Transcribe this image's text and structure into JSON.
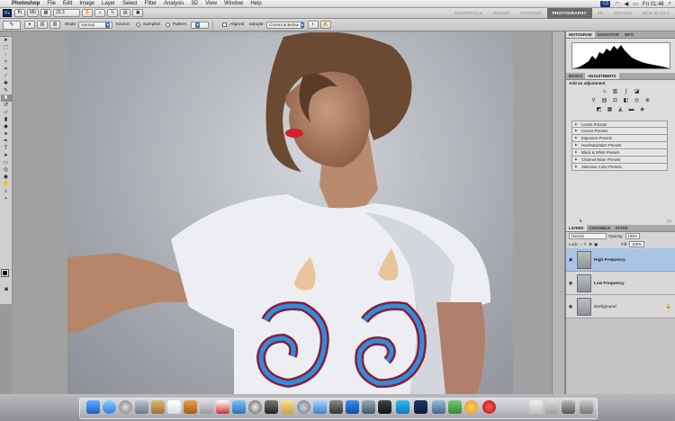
{
  "menubar": {
    "app_name": "Photoshop",
    "items": [
      "File",
      "Edit",
      "Image",
      "Layer",
      "Select",
      "Filter",
      "Analysis",
      "3D",
      "View",
      "Window",
      "Help"
    ],
    "ps_badge": "CS",
    "clock": "Fri 01:48"
  },
  "appbar": {
    "logo": "Ps",
    "zoom": "33.3",
    "workspaces": [
      "ESSENTIALS",
      "DESIGN",
      "PAINTING",
      "PHOTOGRAPHY",
      "3D",
      "MOTION",
      "NEW IN CS 5"
    ],
    "active_workspace": "PHOTOGRAPHY"
  },
  "options": {
    "mode_label": "Mode:",
    "mode_value": "Normal",
    "source_label": "Source:",
    "sampled_label": "Sampled",
    "pattern_label": "Pattern",
    "aligned_label": "Aligned",
    "sample_label": "Sample:",
    "sample_value": "Current & Below"
  },
  "panels": {
    "histogram_tabs": [
      "HISTOGRAM",
      "NAVIGATOR",
      "INFO"
    ],
    "adjust_tabs": [
      "MASKS",
      "ADJUSTMENTS"
    ],
    "adjust_title": "Add an adjustment",
    "presets": [
      "Levels Presets",
      "Curves Presets",
      "Exposure Presets",
      "Hue/Saturation Presets",
      "Black & White Presets",
      "Channel Mixer Presets",
      "Selective Color Presets"
    ],
    "layer_tabs": [
      "LAYERS",
      "CHANNELS",
      "PATHS"
    ],
    "blend_mode": "Normal",
    "opacity_label": "Opacity:",
    "opacity_value": "100%",
    "lock_label": "Lock:",
    "fill_label": "Fill:",
    "fill_value": "100%",
    "layers": [
      {
        "name": "High Frequency",
        "selected": true,
        "italic": false
      },
      {
        "name": "Low Frequency",
        "selected": false,
        "italic": false
      },
      {
        "name": "Background",
        "selected": false,
        "italic": true
      }
    ]
  }
}
